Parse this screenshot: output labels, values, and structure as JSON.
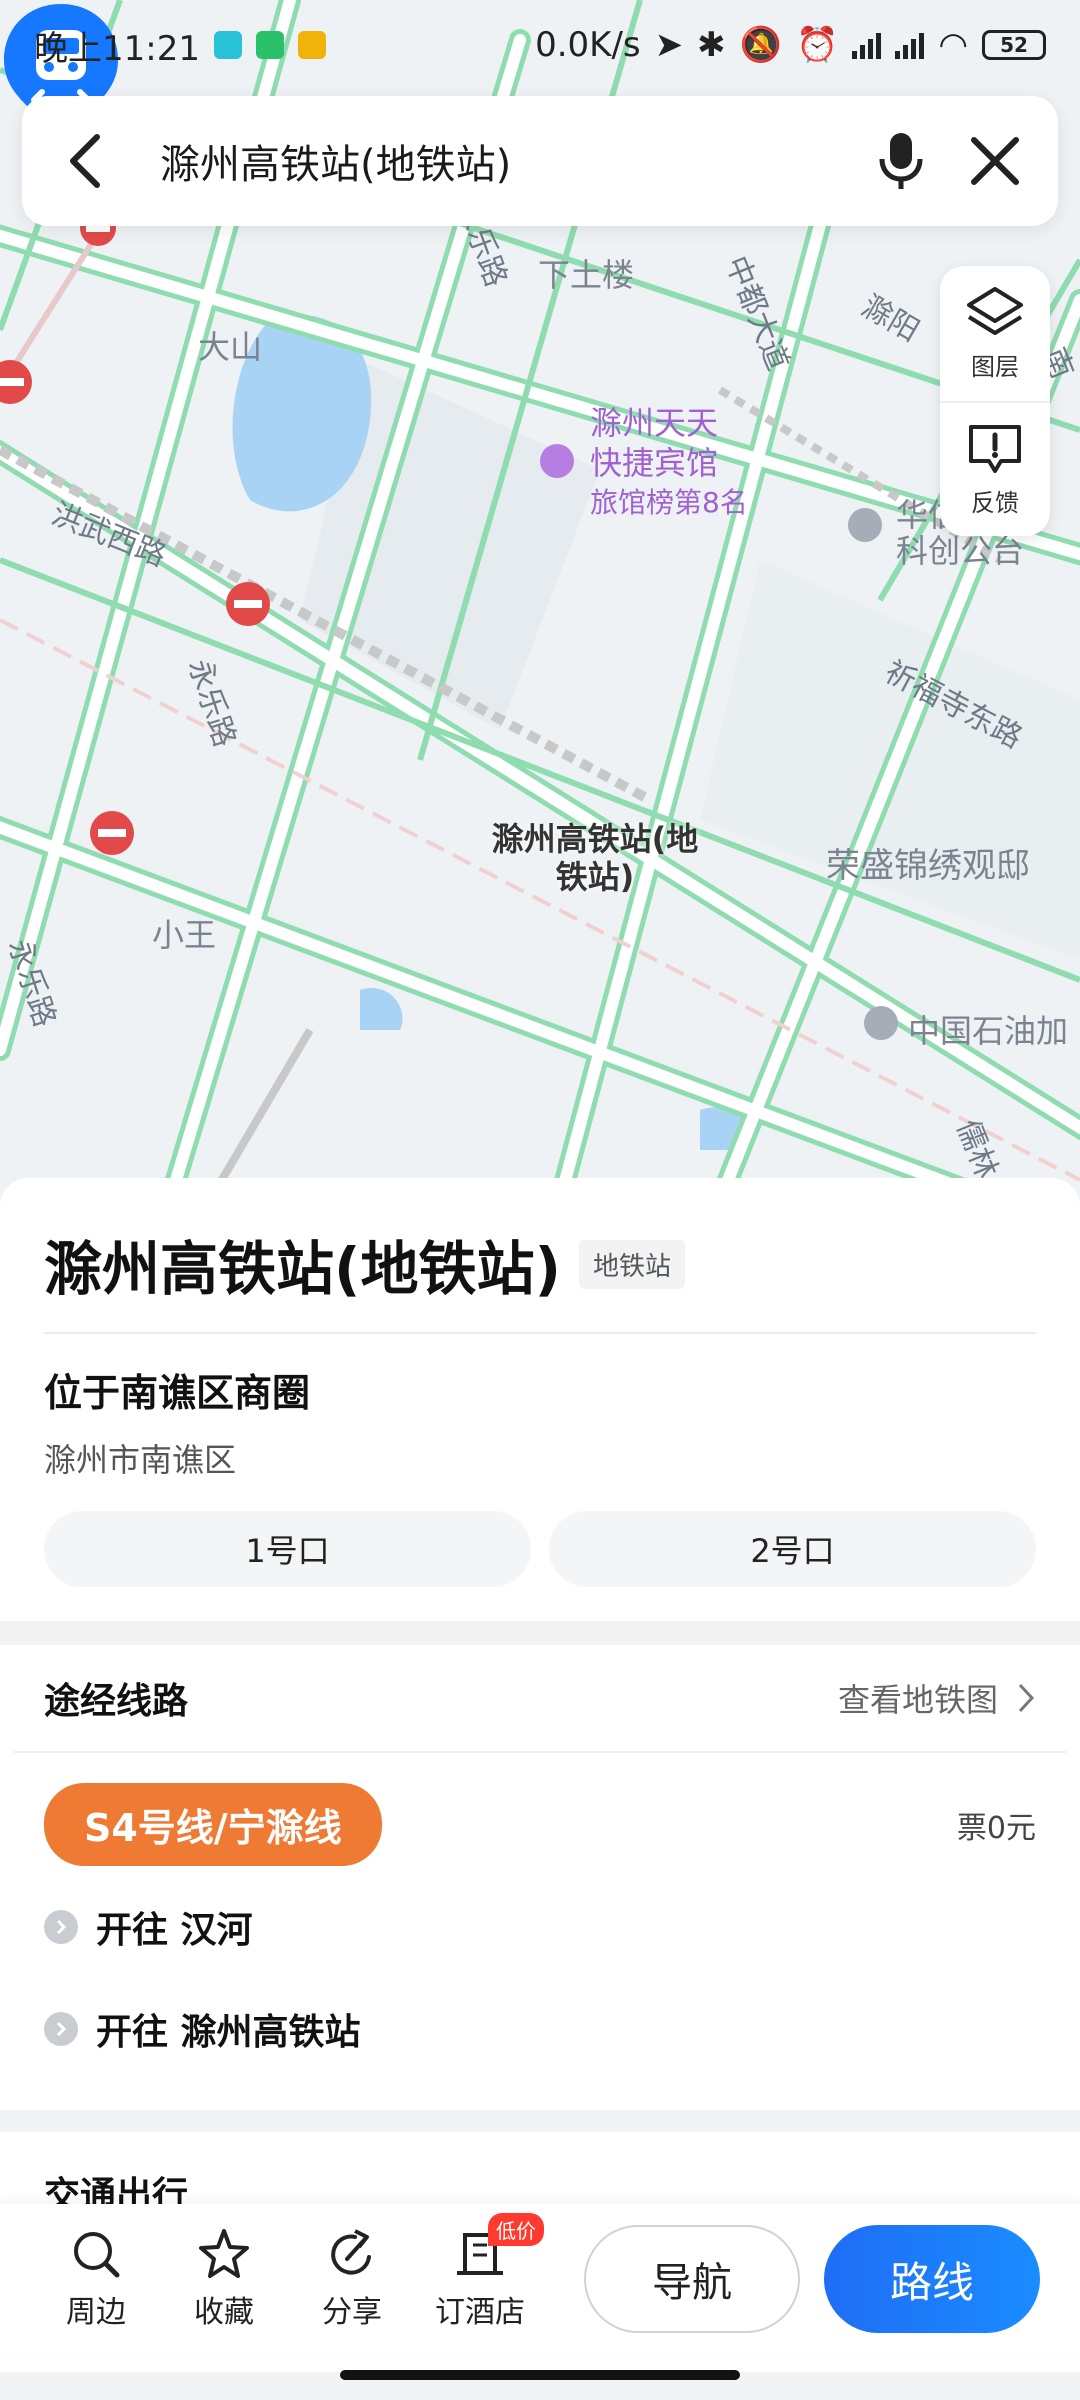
{
  "status_bar": {
    "time": "晚上11:21",
    "net_speed": "0.0K/s",
    "battery": "52"
  },
  "search": {
    "query": "滁州高铁站(地铁站)"
  },
  "map": {
    "side_panel": {
      "layers_label": "图层",
      "feedback_label": "反馈"
    },
    "labels": {
      "xiatulou": "下土楼",
      "dashan": "大山",
      "xiaowang": "小王",
      "rongsheng": "荣盛锦绣观邸",
      "huaxin": "华信",
      "kechuang": "科创公台",
      "sinopec": "中国石油加",
      "hotel_name_1": "滁州天天",
      "hotel_name_2": "快捷宾馆",
      "hotel_rank": "旅馆榜第8名",
      "road_yongle_1": "永乐路",
      "road_yongle_2": "永乐路",
      "road_yongle_3": "永乐路",
      "road_hongwu": "洪武西路",
      "road_zhongdu": "中都大道",
      "road_chuyang": "滁阳",
      "road_qifusi": "祈福寺东路",
      "road_ru": "儒林",
      "road_nan": "南"
    },
    "pin_label_line1": "滁州高铁站(地",
    "pin_label_line2": "铁站)"
  },
  "place": {
    "title": "滁州高铁站(地铁站)",
    "tag": "地铁站",
    "district": "位于南谯区商圈",
    "address": "滁州市南谯区",
    "exits": [
      "1号口",
      "2号口"
    ]
  },
  "lines": {
    "section_title": "途经线路",
    "map_link": "查看地铁图",
    "line_name": "S4号线/宁滁线",
    "fare": "票0元",
    "directions": [
      "开往 汉河",
      "开往 滁州高铁站"
    ],
    "colors": {
      "line": "#ef7a34"
    }
  },
  "transport": {
    "section_title": "交通出行"
  },
  "actions": {
    "nearby": "周边",
    "favorite": "收藏",
    "share": "分享",
    "hotel": "订酒店",
    "hotel_badge": "低价",
    "navigate": "导航",
    "route": "路线"
  }
}
